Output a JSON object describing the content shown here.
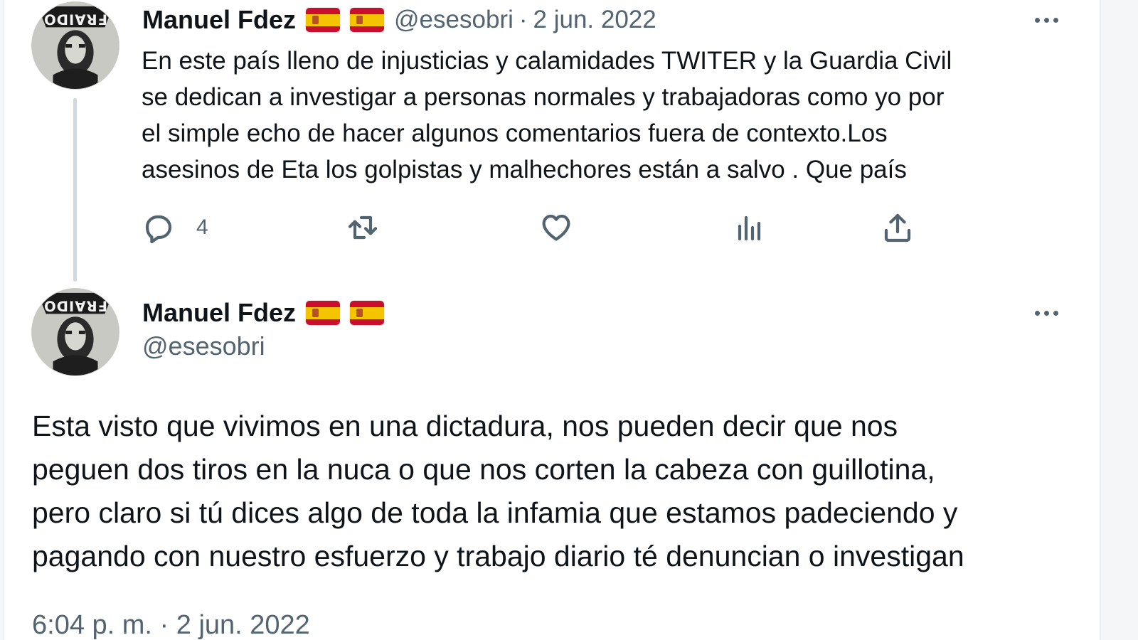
{
  "tweets": [
    {
      "author": {
        "display_name": "Manuel Fdez",
        "flags": [
          "spain-flag-emoji",
          "spain-flag-emoji"
        ],
        "handle": "@esesobri",
        "avatar_text": "FRAIDO"
      },
      "separator": "·",
      "date": "2 jun. 2022",
      "text_lines": [
        "En este país lleno de injusticias y calamidades TWITER y la Guardia Civil",
        "se dedican a investigar  a personas normales y trabajadoras como yo por",
        "el simple echo de hacer algunos comentarios fuera de contexto.Los",
        "asesinos de Eta los golpistas y malhechores están a salvo . Que país"
      ],
      "actions": {
        "reply": {
          "icon": "reply-icon",
          "count": "4"
        },
        "retweet": {
          "icon": "retweet-icon",
          "count": ""
        },
        "like": {
          "icon": "heart-icon",
          "count": ""
        },
        "views": {
          "icon": "analytics-icon",
          "count": ""
        },
        "share": {
          "icon": "share-icon"
        }
      }
    },
    {
      "author": {
        "display_name": "Manuel Fdez",
        "flags": [
          "spain-flag-emoji",
          "spain-flag-emoji"
        ],
        "handle": "@esesobri",
        "avatar_text": "FRAIDO"
      },
      "text_lines": [
        "Esta visto que vivimos en una dictadura, nos pueden decir que nos",
        "peguen dos tiros en la nuca o que nos corten la cabeza con guillotina,",
        "pero claro si tú dices algo de toda la infamia que estamos padeciendo y",
        "pagando con nuestro esfuerzo y trabajo diario té denuncian o investigan"
      ],
      "timestamp": "6:04 p. m. · 2 jun. 2022"
    }
  ],
  "colors": {
    "text_primary": "#0f1419",
    "text_secondary": "#536471",
    "thread_line": "#cfd9de",
    "flag_red": "#c8102e",
    "flag_yellow": "#f5c400"
  }
}
